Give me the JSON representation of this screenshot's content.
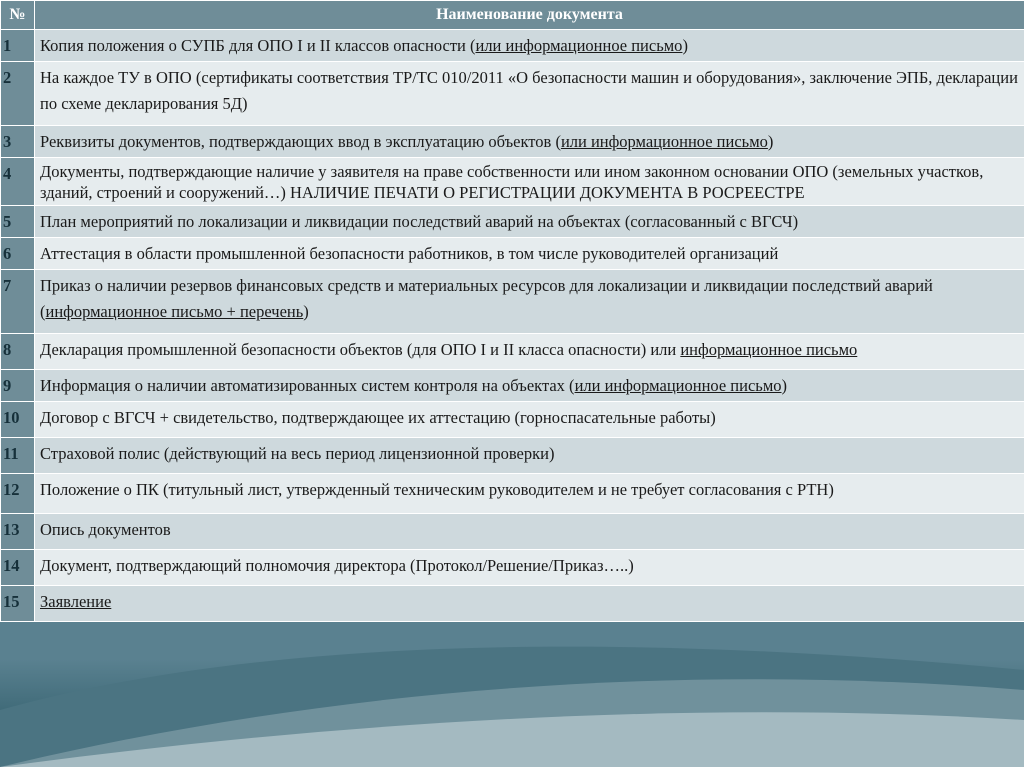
{
  "table": {
    "header_num": "№",
    "header_name": "Наименование документа",
    "rows": [
      {
        "num": "1",
        "t1": "Копия положения о СУПБ для ОПО I и II классов опасности (",
        "u": "или информационное письмо",
        "t2": ")"
      },
      {
        "num": "2",
        "t1": "На каждое ТУ в ОПО (сертификаты соответствия ТР/ТС 010/2011 «О безопасности машин и оборудования», заключение ЭПБ, декларации по схеме декларирования 5Д)",
        "u": "",
        "t2": ""
      },
      {
        "num": "3",
        "t1": "Реквизиты документов, подтверждающих ввод в эксплуатацию объектов (",
        "u": "или информационное письмо",
        "t2": ")"
      },
      {
        "num": "4",
        "t1": "Документы, подтверждающие наличие у заявителя на праве собственности или ином законном основании ОПО (земельных участков, зданий, строений и сооружений…) НАЛИЧИЕ ПЕЧАТИ О РЕГИСТРАЦИИ ДОКУМЕНТА В РОСРЕЕСТРЕ",
        "u": "",
        "t2": ""
      },
      {
        "num": "5",
        "t1": "План мероприятий по локализации и ликвидации последствий аварий на объектах (согласованный с ВГСЧ)",
        "u": "",
        "t2": ""
      },
      {
        "num": "6",
        "t1": "Аттестация в области промышленной безопасности работников, в том числе руководителей организаций",
        "u": "",
        "t2": ""
      },
      {
        "num": "7",
        "t1": "Приказ о наличии резервов финансовых средств и материальных ресурсов для локализации и ликвидации последствий аварий (",
        "u": "информационное письмо + перечень",
        "t2": ")"
      },
      {
        "num": "8",
        "t1": "Декларация промышленной безопасности объектов (для ОПО I и II класса опасности) или ",
        "u": "информационное письмо",
        "t2": ""
      },
      {
        "num": "9",
        "t1": "Информация о наличии автоматизированных систем контроля на объектах (",
        "u": "или информационное письмо",
        "t2": ")"
      },
      {
        "num": "10",
        "t1": "Договор с ВГСЧ + свидетельство, подтверждающее их аттестацию (горноспасательные работы)",
        "u": "",
        "t2": ""
      },
      {
        "num": "11",
        "t1": "Страховой полис (действующий на весь период лицензионной проверки)",
        "u": "",
        "t2": ""
      },
      {
        "num": "12",
        "t1": "Положение о ПК (титульный лист, утвержденный техническим руководителем и не требует согласования с РТН)",
        "u": "",
        "t2": ""
      },
      {
        "num": "13",
        "t1": "Опись документов",
        "u": "",
        "t2": ""
      },
      {
        "num": "14",
        "t1": "Документ, подтверждающий полномочия директора (Протокол/Решение/Приказ…..)",
        "u": "",
        "t2": ""
      },
      {
        "num": "15",
        "t1": "",
        "u": "Заявление",
        "t2": ""
      }
    ]
  },
  "colors": {
    "header_bg": "#6f8d98",
    "row_odd": "#ced9dd",
    "row_even": "#e6ecee",
    "page_bg": "#5a8190"
  }
}
